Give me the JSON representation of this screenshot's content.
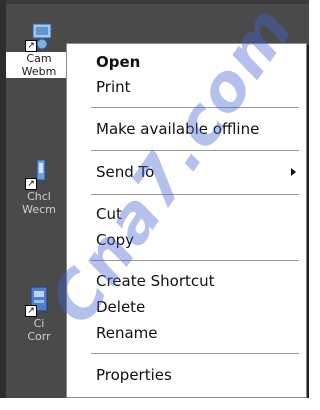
{
  "desktop": {
    "icons": [
      {
        "label": "Cam",
        "label2": "Webm"
      },
      {
        "label": "Chcl",
        "label2": "Wecm"
      },
      {
        "label": "Ci",
        "label2": "Corr"
      }
    ]
  },
  "context_menu": {
    "items": [
      {
        "label": "Open",
        "bold": true
      },
      {
        "label": "Print"
      },
      {
        "label": "Make available offline"
      },
      {
        "label": "Send To",
        "submenu": true
      },
      {
        "label": "Cut"
      },
      {
        "label": "Copy"
      },
      {
        "label": "Create Shortcut"
      },
      {
        "label": "Delete"
      },
      {
        "label": "Rename"
      },
      {
        "label": "Properties"
      }
    ]
  },
  "watermark": {
    "text": "Cna7.com"
  },
  "colors": {
    "desktop_bg": "#4a4a4a",
    "menu_bg": "#ffffff",
    "menu_text": "#111111",
    "watermark": "#4664d2"
  },
  "icon_names": [
    "webcam-shortcut-icon",
    "monitor-shortcut-icon",
    "network-shortcut-icon",
    "shortcut-arrow-icon",
    "submenu-arrow-icon"
  ]
}
